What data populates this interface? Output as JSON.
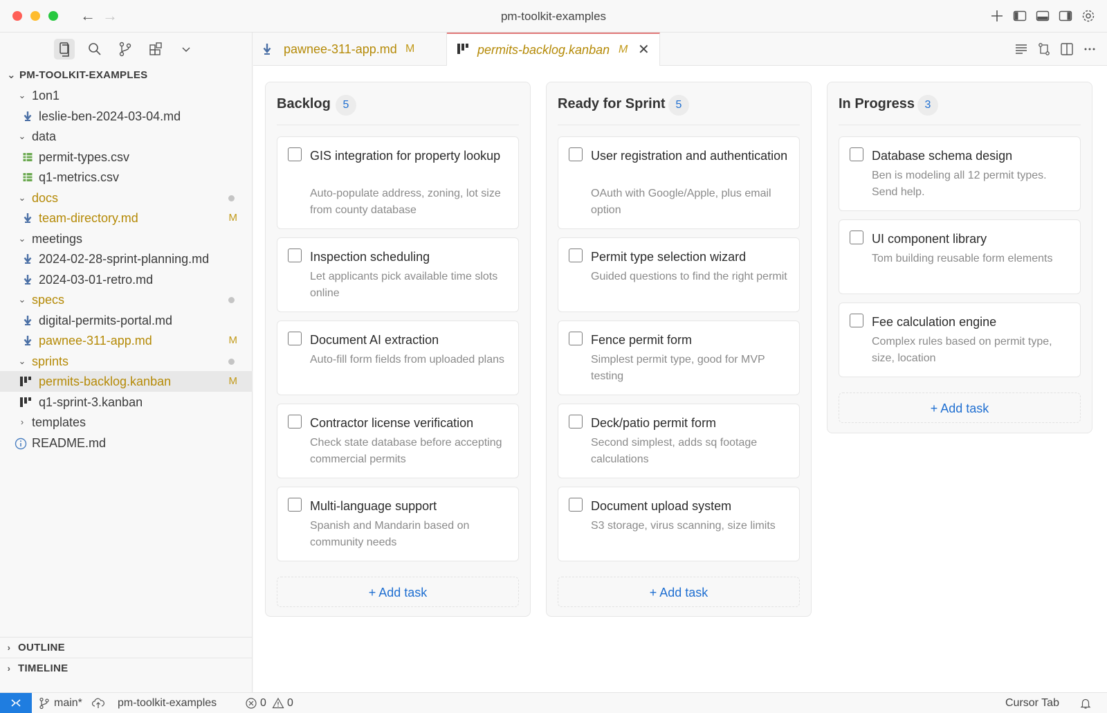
{
  "window": {
    "title": "pm-toolkit-examples"
  },
  "sidebar": {
    "root": "PM-TOOLKIT-EXAMPLES",
    "tree": [
      {
        "label": "1on1",
        "type": "folder"
      },
      {
        "label": "leslie-ben-2024-03-04.md",
        "type": "md"
      },
      {
        "label": "data",
        "type": "folder"
      },
      {
        "label": "permit-types.csv",
        "type": "csv"
      },
      {
        "label": "q1-metrics.csv",
        "type": "csv"
      },
      {
        "label": "docs",
        "type": "folder",
        "modified": true
      },
      {
        "label": "team-directory.md",
        "type": "md",
        "modified": true,
        "badge": "M"
      },
      {
        "label": "meetings",
        "type": "folder"
      },
      {
        "label": "2024-02-28-sprint-planning.md",
        "type": "md"
      },
      {
        "label": "2024-03-01-retro.md",
        "type": "md"
      },
      {
        "label": "specs",
        "type": "folder",
        "modified": true
      },
      {
        "label": "digital-permits-portal.md",
        "type": "md"
      },
      {
        "label": "pawnee-311-app.md",
        "type": "md",
        "modified": true,
        "badge": "M"
      },
      {
        "label": "sprints",
        "type": "folder",
        "modified": true
      },
      {
        "label": "permits-backlog.kanban",
        "type": "kanban",
        "modified": true,
        "badge": "M",
        "selected": true
      },
      {
        "label": "q1-sprint-3.kanban",
        "type": "kanban"
      },
      {
        "label": "templates",
        "type": "folder-collapsed"
      },
      {
        "label": "README.md",
        "type": "info"
      }
    ],
    "outline": "OUTLINE",
    "timeline": "TIMELINE"
  },
  "tabs": [
    {
      "label": "pawnee-311-app.md",
      "badge": "M"
    },
    {
      "label": "permits-backlog.kanban",
      "badge": "M",
      "close": "✕"
    }
  ],
  "board": {
    "columns": [
      {
        "title": "Backlog",
        "count": "5",
        "cards": [
          {
            "title": "GIS integration for property lookup",
            "desc": "Auto-populate address, zoning, lot size from county database"
          },
          {
            "title": "Inspection scheduling",
            "desc": "Let applicants pick available time slots online"
          },
          {
            "title": "Document AI extraction",
            "desc": "Auto-fill form fields from uploaded plans"
          },
          {
            "title": "Contractor license verification",
            "desc": "Check state database before accepting commercial permits"
          },
          {
            "title": "Multi-language support",
            "desc": "Spanish and Mandarin based on community needs"
          }
        ],
        "add_label": "+ Add task"
      },
      {
        "title": "Ready for Sprint",
        "count": "5",
        "cards": [
          {
            "title": "User registration and authentication",
            "desc": "OAuth with Google/Apple, plus email option"
          },
          {
            "title": "Permit type selection wizard",
            "desc": "Guided questions to find the right permit"
          },
          {
            "title": "Fence permit form",
            "desc": "Simplest permit type, good for MVP testing"
          },
          {
            "title": "Deck/patio permit form",
            "desc": "Second simplest, adds sq footage calculations"
          },
          {
            "title": "Document upload system",
            "desc": "S3 storage, virus scanning, size limits"
          }
        ],
        "add_label": "+ Add task"
      },
      {
        "title": "In Progress",
        "count": "3",
        "cards": [
          {
            "title": "Database schema design",
            "desc": "Ben is modeling all 12 permit types. Send help."
          },
          {
            "title": "UI component library",
            "desc": "Tom building reusable form elements"
          },
          {
            "title": "Fee calculation engine",
            "desc": "Complex rules based on permit type, size, location"
          }
        ],
        "add_label": "+ Add task"
      }
    ]
  },
  "statusbar": {
    "branch": "main*",
    "project": "pm-toolkit-examples",
    "errors": "0",
    "warnings": "0",
    "right_label": "Cursor Tab"
  },
  "colors": {
    "accent": "#1f6fd1",
    "modified": "#b58a07",
    "remote": "#1f7de0",
    "tab_border": "#e27a7a"
  }
}
